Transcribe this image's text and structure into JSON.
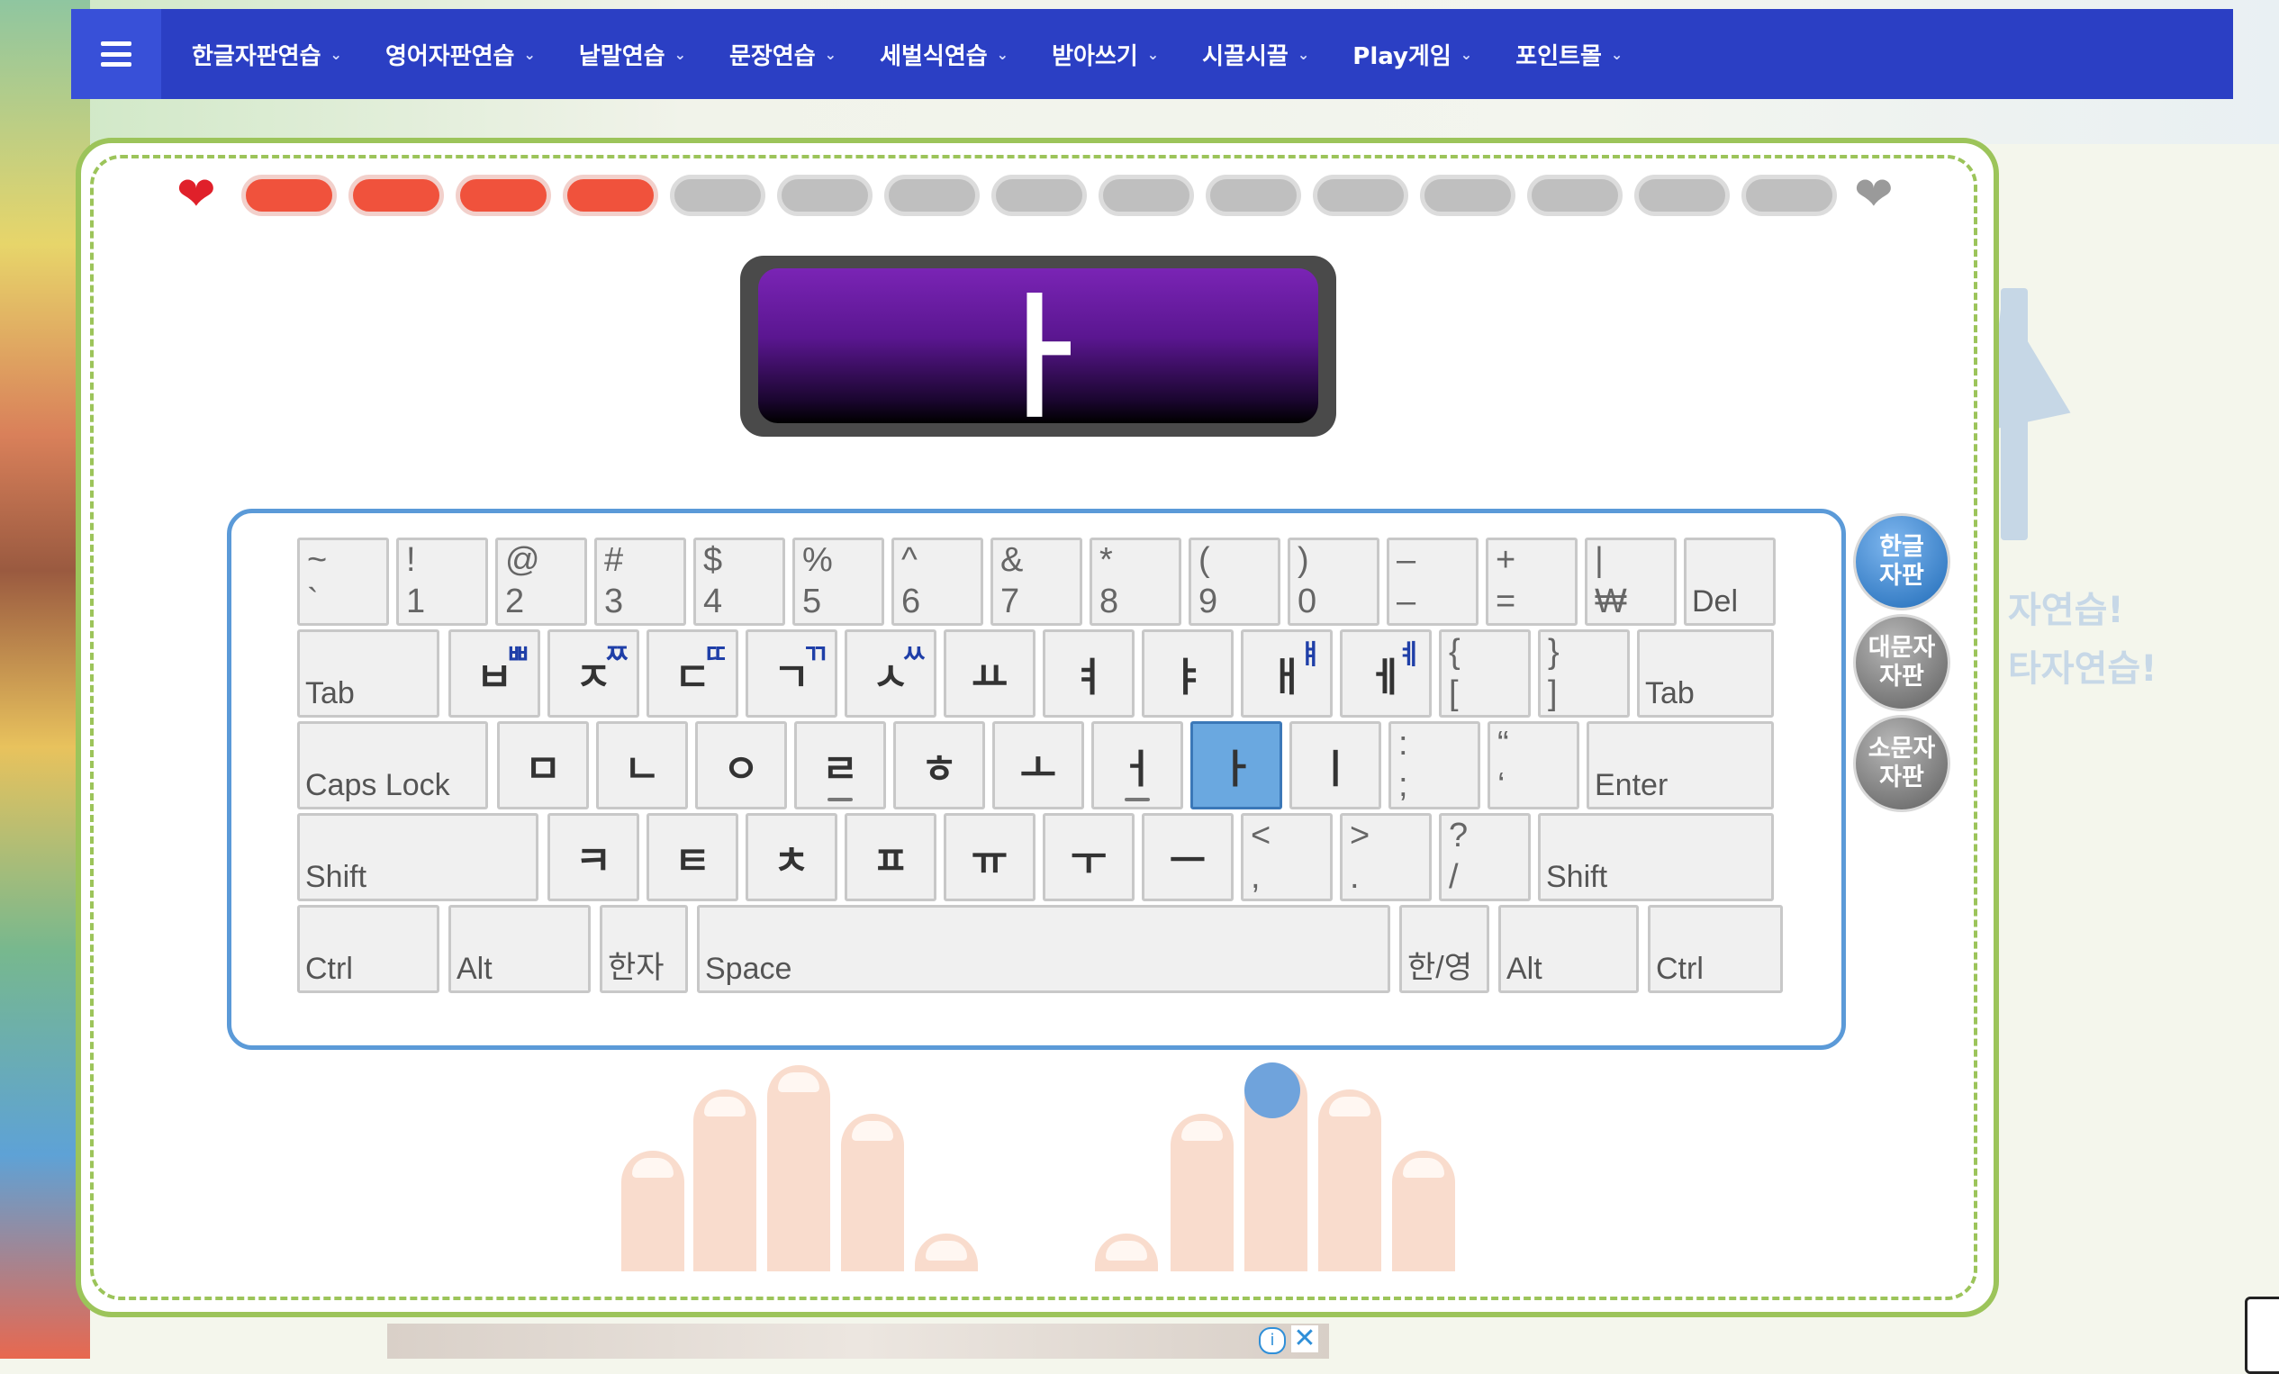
{
  "nav": {
    "items": [
      "한글자판연습",
      "영어자판연습",
      "낱말연습",
      "문장연습",
      "세벌식연습",
      "받아쓰기",
      "시끌시끌",
      "Play게임",
      "포인트몰"
    ]
  },
  "progress": {
    "completed": 4,
    "total": 15
  },
  "display": {
    "char": "ㅏ"
  },
  "side_buttons": {
    "korean": "한글\n자판",
    "upper": "대문자\n자판",
    "lower": "소문자\n자판"
  },
  "background_text": [
    "자연습!",
    "타자연습!"
  ],
  "keyboard": {
    "row1": [
      [
        "~",
        "`"
      ],
      [
        "!",
        "1"
      ],
      [
        "@",
        "2"
      ],
      [
        "#",
        "3"
      ],
      [
        "$",
        "4"
      ],
      [
        "%",
        "5"
      ],
      [
        "^",
        "6"
      ],
      [
        "&",
        "7"
      ],
      [
        "*",
        "8"
      ],
      [
        "(",
        "9"
      ],
      [
        ")",
        "0"
      ],
      [
        "–",
        "–"
      ],
      [
        "+",
        "="
      ],
      [
        "|",
        "₩"
      ]
    ],
    "row1_del": "Del",
    "tab": "Tab",
    "row2": [
      [
        "ㅂ",
        "ㅃ"
      ],
      [
        "ㅈ",
        "ㅉ"
      ],
      [
        "ㄷ",
        "ㄸ"
      ],
      [
        "ㄱ",
        "ㄲ"
      ],
      [
        "ㅅ",
        "ㅆ"
      ],
      [
        "ㅛ",
        ""
      ],
      [
        "ㅕ",
        ""
      ],
      [
        "ㅑ",
        ""
      ],
      [
        "ㅐ",
        "ㅒ"
      ],
      [
        "ㅔ",
        "ㅖ"
      ]
    ],
    "row2_sym": [
      [
        "{",
        "["
      ],
      [
        "}",
        "]"
      ]
    ],
    "tab_right": "Tab",
    "caps": "Caps Lock",
    "row3": [
      "ㅁ",
      "ㄴ",
      "ㅇ",
      "ㄹ",
      "ㅎ",
      "ㅗ",
      "ㅓ",
      "ㅏ",
      "ㅣ"
    ],
    "row3_sym": [
      [
        ":",
        ";"
      ],
      [
        "“",
        "‘"
      ]
    ],
    "enter": "Enter",
    "shift": "Shift",
    "row4": [
      "ㅋ",
      "ㅌ",
      "ㅊ",
      "ㅍ",
      "ㅠ",
      "ㅜ",
      "ㅡ"
    ],
    "row4_sym": [
      [
        "<",
        ","
      ],
      [
        ">",
        "."
      ],
      [
        "?",
        "/"
      ]
    ],
    "shift_right": "Shift",
    "bottom": {
      "ctrl": "Ctrl",
      "alt": "Alt",
      "hanja": "한자",
      "space": "Space",
      "hanyeong": "한/영",
      "alt_r": "Alt",
      "ctrl_r": "Ctrl"
    },
    "active_key": "ㅏ"
  },
  "colors": {
    "nav_bg": "#2b3fc4",
    "done": "#f0523c",
    "todo": "#bfbfbf",
    "active_key": "#6aa8e0",
    "border_green": "#9cc45a",
    "keyboard_border": "#5b9ad8"
  }
}
